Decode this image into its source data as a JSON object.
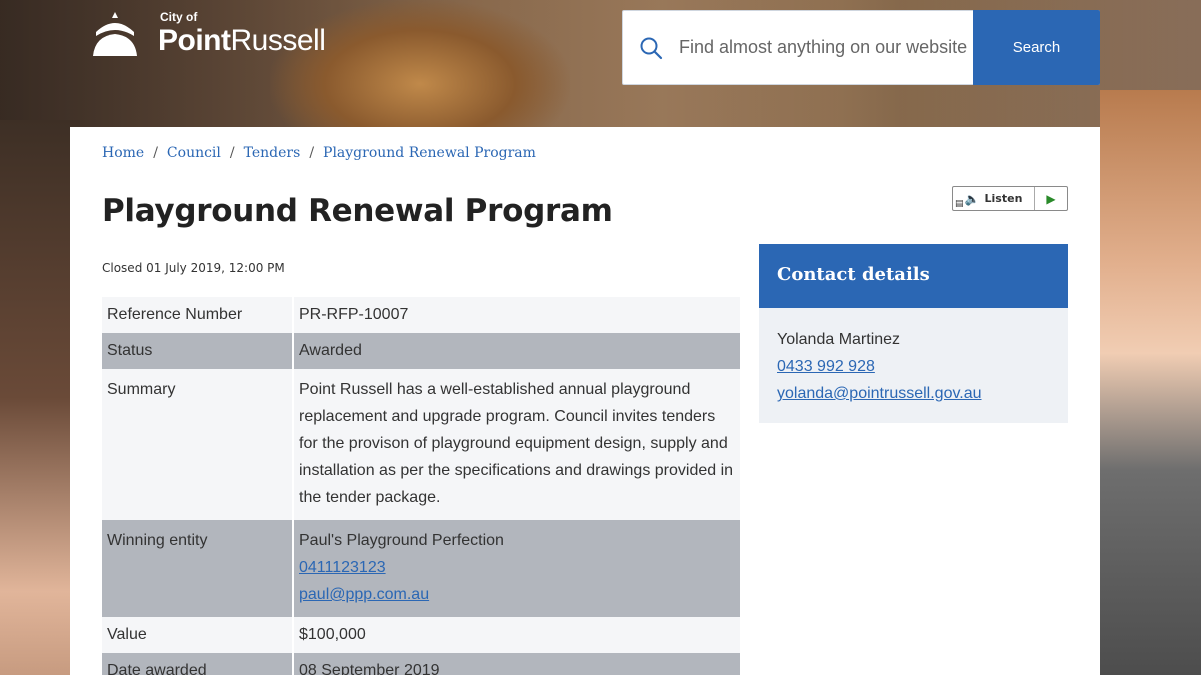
{
  "header": {
    "logo_small": "City of",
    "logo_word1": "Point",
    "logo_word2": "Russell",
    "search_placeholder": "Find almost anything on our website",
    "search_button": "Search"
  },
  "breadcrumb": [
    "Home",
    "Council",
    "Tenders",
    "Playground Renewal Program"
  ],
  "page": {
    "title": "Playground Renewal Program",
    "closed": "Closed 01 July 2019, 12:00 PM"
  },
  "listen": {
    "label": "Listen"
  },
  "details": [
    {
      "key": "Reference Number",
      "value": "PR-RFP-10007"
    },
    {
      "key": "Status",
      "value": "Awarded"
    },
    {
      "key": "Summary",
      "value": "Point Russell has a well-established annual playground replacement and upgrade program. Council invites tenders for the provison of playground equipment design, supply and installation as per the specifications and drawings provided in the tender package."
    },
    {
      "key": "Winning entity",
      "value": "Paul's Playground Perfection",
      "phone": "0411123123",
      "email": "paul@ppp.com.au"
    },
    {
      "key": "Value",
      "value": "$100,000"
    },
    {
      "key": "Date awarded",
      "value": "08 September 2019"
    }
  ],
  "contact": {
    "heading": "Contact details",
    "name": "Yolanda Martinez",
    "phone": "0433 992 928",
    "email": "yolanda@pointrussell.gov.au"
  },
  "colors": {
    "primary": "#2b67b4",
    "row_light": "#f5f6f8",
    "row_dark": "#b2b6bd",
    "contact_bg": "#eef1f5"
  }
}
